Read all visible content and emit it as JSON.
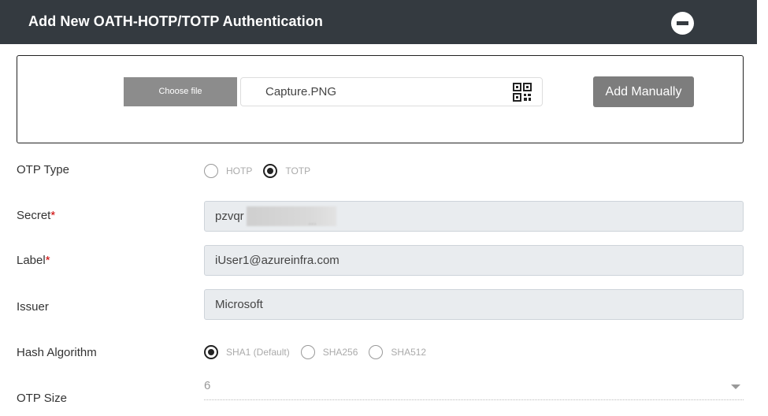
{
  "header": {
    "title": "Add New OATH-HOTP/TOTP Authentication",
    "collapse_icon": "minus-circle-icon"
  },
  "upload": {
    "choose_label": "Choose file",
    "file_name": "Capture.PNG",
    "qr_icon": "qr-code-icon",
    "add_manually_label": "Add Manually"
  },
  "form": {
    "otp_type": {
      "label": "OTP Type",
      "options": [
        "HOTP",
        "TOTP"
      ],
      "selected": "TOTP"
    },
    "secret": {
      "label": "Secret",
      "required": "*",
      "value": "pzvqr",
      "redacted_suffix": "…"
    },
    "label_field": {
      "label": "Label",
      "required": "*",
      "value": "iUser1@azureinfra.com"
    },
    "issuer": {
      "label": "Issuer",
      "value": "Microsoft"
    },
    "hash_algorithm": {
      "label": "Hash Algorithm",
      "options": [
        "SHA1 (Default)",
        "SHA256",
        "SHA512"
      ],
      "selected": "SHA1 (Default)"
    },
    "otp_size": {
      "label": "OTP Size",
      "value": "6"
    }
  },
  "colors": {
    "header_bg": "#343a40",
    "button_bg": "#8c8c8c",
    "required": "#cc0000",
    "input_bg": "#e9ecef"
  }
}
